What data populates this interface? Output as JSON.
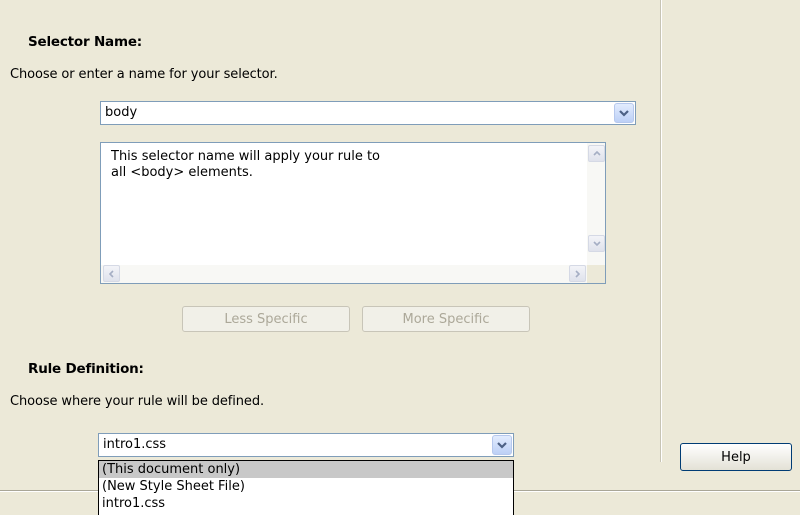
{
  "selector_section": {
    "heading": "Selector Name:",
    "description": "Choose or enter a name for your selector.",
    "selector_value": "body",
    "explanation": "This selector name will apply your rule to\nall <body> elements."
  },
  "specificity": {
    "less_label": "Less Specific",
    "more_label": "More Specific"
  },
  "rule_section": {
    "heading": "Rule Definition:",
    "description": "Choose where your rule will be defined.",
    "rule_value": "intro1.css",
    "options": [
      {
        "label": "(This document only)",
        "selected": true
      },
      {
        "label": "(New Style Sheet File)",
        "selected": false
      },
      {
        "label": "intro1.css",
        "selected": false
      }
    ]
  },
  "help_button": {
    "label": "Help"
  },
  "icons": [
    "chevron-down-icon",
    "scroll-up-icon",
    "scroll-down-icon",
    "scroll-left-icon",
    "scroll-right-icon"
  ],
  "colors": {
    "background": "#ece9d8",
    "field_border": "#7f9db9",
    "disabled_text": "#aca899",
    "highlight": "#c8c8c8"
  }
}
